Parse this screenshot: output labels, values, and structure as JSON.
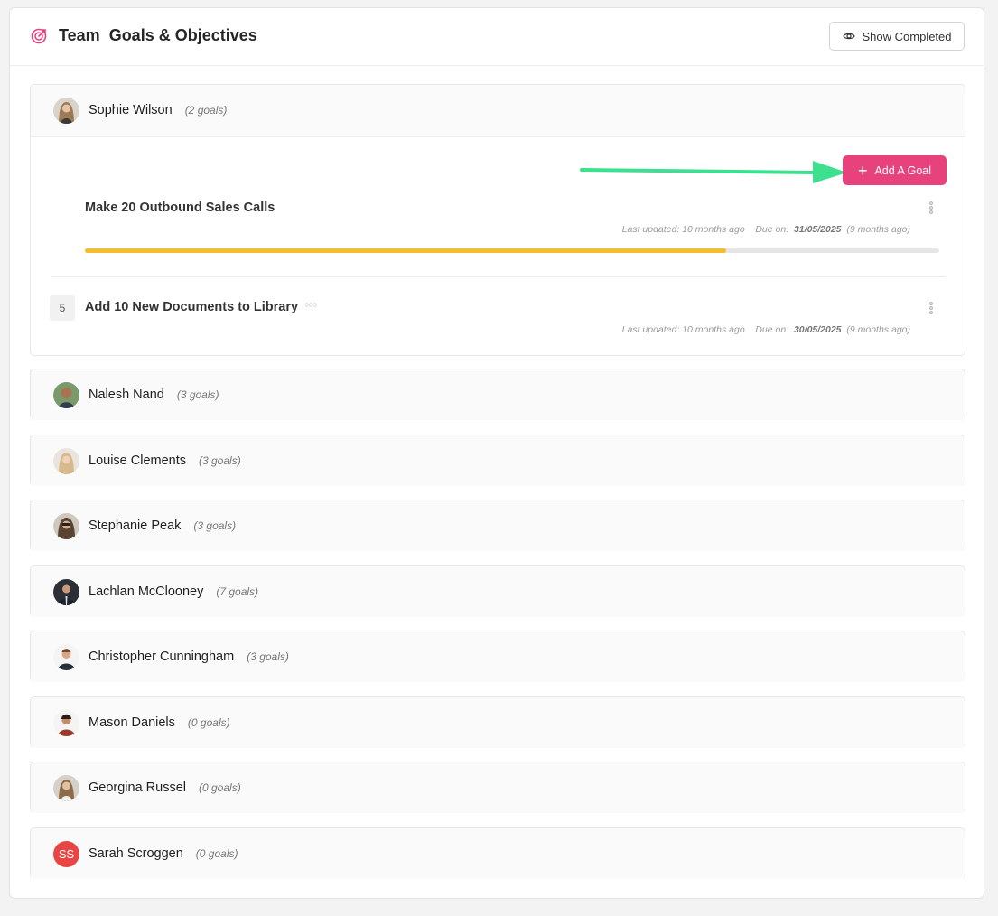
{
  "header": {
    "title": "Team  Goals & Objectives",
    "show_completed_label": "Show Completed",
    "icon": "target-icon",
    "accent_color": "#e8427c"
  },
  "members": [
    {
      "name": "Sophie Wilson",
      "count": "(2 goals)",
      "avatar": "photo"
    },
    {
      "name": "Nalesh Nand",
      "count": "(3 goals)",
      "avatar": "photo"
    },
    {
      "name": "Louise Clements",
      "count": "(3 goals)",
      "avatar": "photo"
    },
    {
      "name": "Stephanie Peak",
      "count": "(3 goals)",
      "avatar": "photo"
    },
    {
      "name": "Lachlan McClooney",
      "count": "(7 goals)",
      "avatar": "photo"
    },
    {
      "name": "Christopher Cunningham",
      "count": "(3 goals)",
      "avatar": "photo"
    },
    {
      "name": "Mason Daniels",
      "count": "(0 goals)",
      "avatar": "photo"
    },
    {
      "name": "Georgina Russel",
      "count": "(0 goals)",
      "avatar": "photo"
    },
    {
      "name": "Sarah Scroggen",
      "count": "(0 goals)",
      "avatar": "initials",
      "initials": "SS",
      "avatar_color": "#e84545"
    }
  ],
  "expanded": {
    "add_goal_label": "Add A Goal",
    "goals": [
      {
        "title": "Make 20 Outbound Sales Calls",
        "last_updated_label": "Last updated: 10 months ago",
        "due_label": "Due on:",
        "due_date": "31/05/2025",
        "due_relative": "(9 months ago)",
        "progress": 0.75,
        "progress_color": "#f5be2c"
      },
      {
        "number": "5",
        "title": "Add 10 New Documents to Library",
        "last_updated_label": "Last updated: 10 months ago",
        "due_label": "Due on:",
        "due_date": "30/05/2025",
        "due_relative": "(9 months ago)"
      }
    ]
  }
}
